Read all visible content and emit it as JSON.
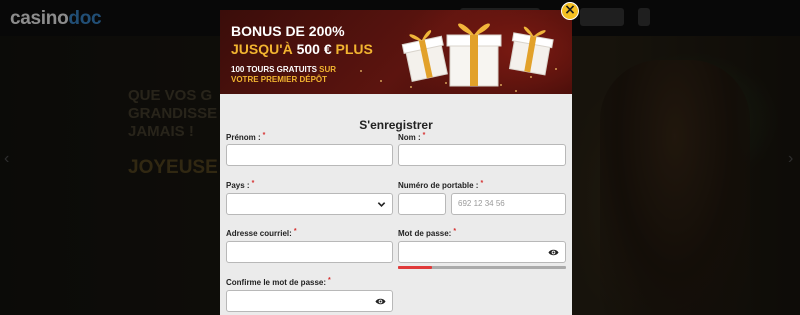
{
  "header": {
    "logo_main": "casino",
    "logo_accent": "doc"
  },
  "background": {
    "hero_line1": "QUE VOS G",
    "hero_line2": "GRANDISSE",
    "hero_line3": "JAMAIS !",
    "hero_line4": "JOYEUSE"
  },
  "banner": {
    "title": "BONUS DE 200%",
    "line2_gold": "JUSQU'À ",
    "line2_white": "500 € ",
    "line2_plus": "PLUS",
    "small_line1_white": "100 TOURS GRATUITS ",
    "small_line1_gold": "SUR",
    "small_line2_gold": "VOTRE PREMIER DÉPÔT"
  },
  "close_label": "×",
  "form": {
    "title": "S'enregistrer",
    "required_marker": "*",
    "first_name": {
      "label": "Prénom :",
      "value": ""
    },
    "last_name": {
      "label": "Nom :",
      "value": ""
    },
    "country": {
      "label": "Pays :",
      "selected": ""
    },
    "mobile": {
      "label": "Numéro de portable :",
      "prefix": "",
      "placeholder": "692 12 34 56"
    },
    "email": {
      "label": "Adresse courriel:",
      "value": ""
    },
    "password": {
      "label": "Mot de passe:",
      "value": "",
      "strength": 0.2
    },
    "confirm_password": {
      "label": "Confirme le mot de passe:",
      "value": ""
    }
  },
  "colors": {
    "accent_gold": "#f2b430",
    "banner_red": "#5c140f",
    "required_red": "#d62e2e",
    "strength_weak": "#e03a3a"
  }
}
